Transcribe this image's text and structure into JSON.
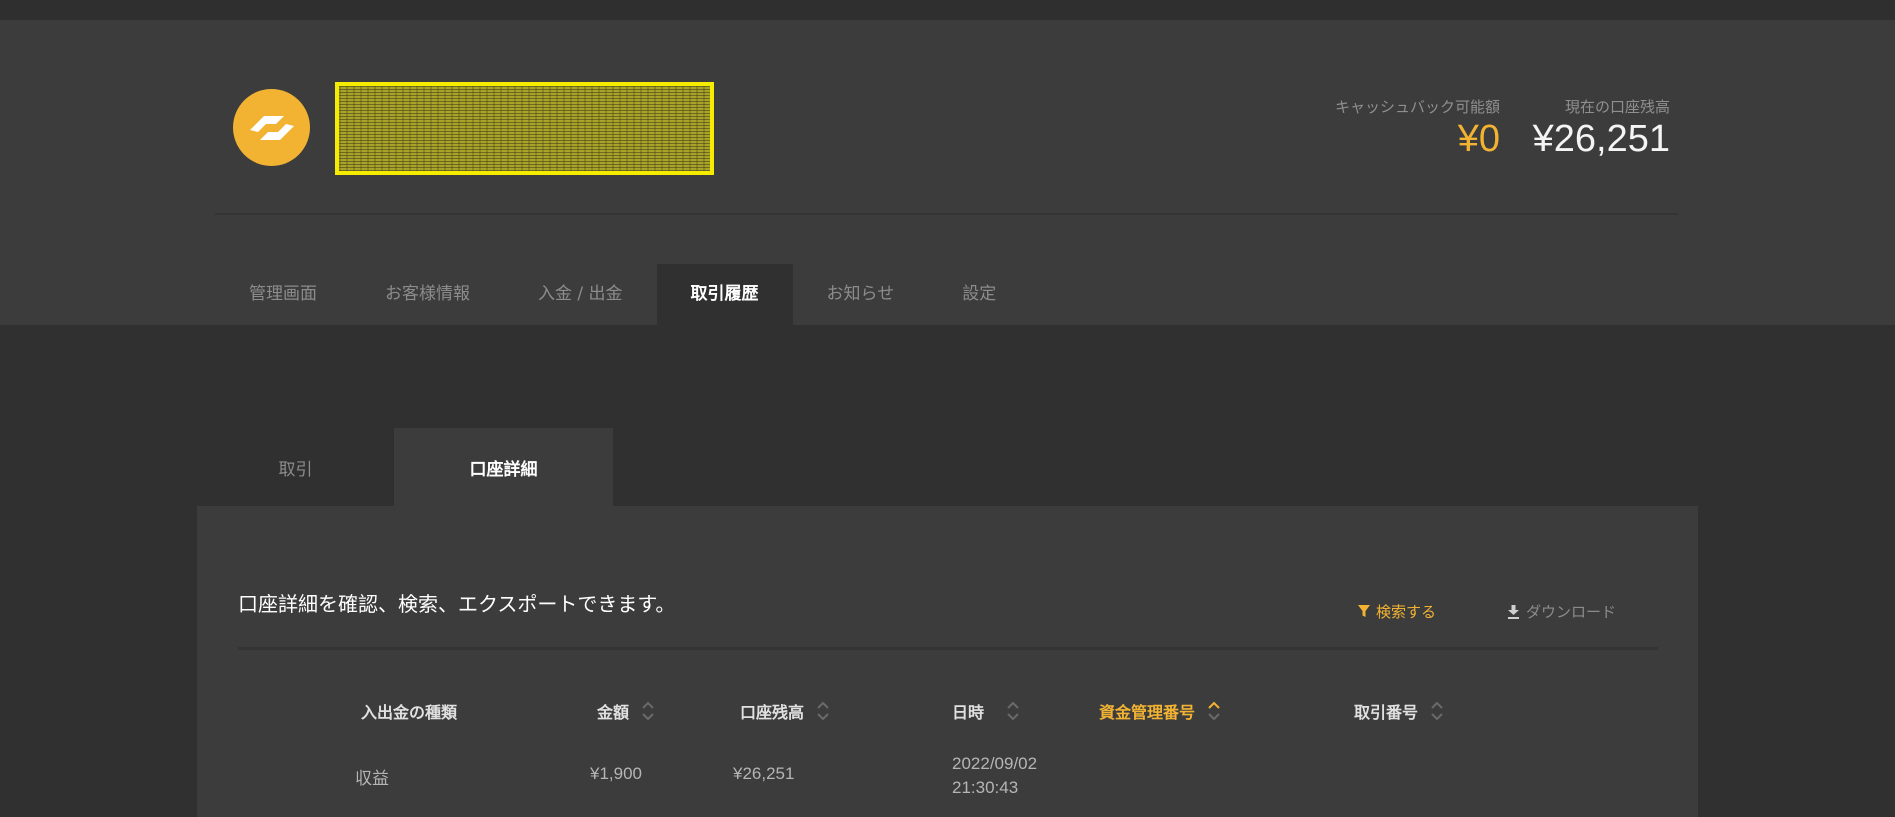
{
  "header": {
    "cashback_label": "キャッシュバック可能額",
    "cashback_value": "¥0",
    "balance_label": "現在の口座残高",
    "balance_value": "¥26,251"
  },
  "nav": {
    "items": [
      "管理画面",
      "お客様情報",
      "入金 / 出金",
      "取引履歴",
      "お知らせ",
      "設定"
    ],
    "active": "取引履歴"
  },
  "subtabs": {
    "items": [
      "取引",
      "口座詳細"
    ],
    "active": "口座詳細"
  },
  "panel": {
    "description": "口座詳細を確認、検索、エクスポートできます。",
    "search_label": "検索する",
    "download_label": "ダウンロード"
  },
  "table": {
    "columns": [
      "入出金の種類",
      "金額",
      "口座残高",
      "日時",
      "資金管理番号",
      "取引番号"
    ],
    "rows": [
      {
        "type": "収益",
        "amount": "¥1,900",
        "balance": "¥26,251",
        "date": "2022/09/02",
        "time": "21:30:43",
        "fund_id": "",
        "trade_id": ""
      }
    ]
  },
  "colors": {
    "accent": "#f2b333",
    "header_bg": "#3c3c3c",
    "page_bg": "#303030"
  }
}
